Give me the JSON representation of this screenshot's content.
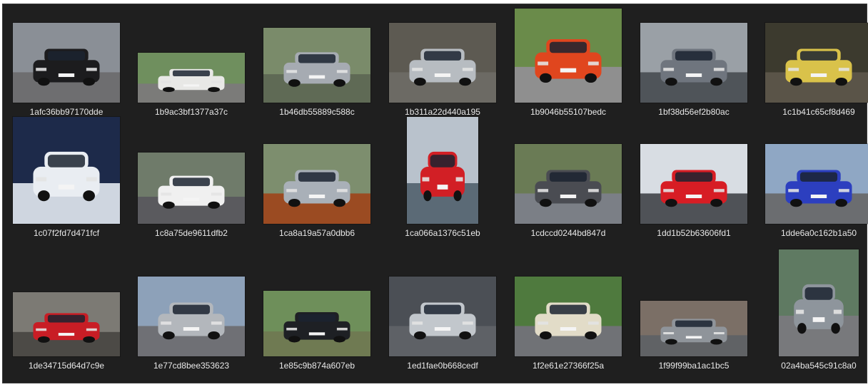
{
  "folder": {
    "files": [
      {
        "name": "1afc36bb97170dde",
        "car_color": "#1c1c1e",
        "bg": "#8a8f96",
        "ground": "#6e6e70"
      },
      {
        "name": "1b9ac3bf1377a37c",
        "car_color": "#e8e8e6",
        "bg": "#6f8f5e",
        "ground": "#7b7b79"
      },
      {
        "name": "1b46db55889c588c",
        "car_color": "#a6abb2",
        "bg": "#7a8b6a",
        "ground": "#5f6a55"
      },
      {
        "name": "1b311a22d440a195",
        "car_color": "#b7bcc1",
        "bg": "#5d5a52",
        "ground": "#6c6a64"
      },
      {
        "name": "1b9046b55107bedc",
        "car_color": "#e0461e",
        "bg": "#6a8b4a",
        "ground": "#8f8f8f"
      },
      {
        "name": "1bf38d56ef2b80ac",
        "car_color": "#6f757e",
        "bg": "#9aa0a6",
        "ground": "#4f5459"
      },
      {
        "name": "1c1b41c65cf8d469",
        "car_color": "#d9c24a",
        "bg": "#3c3a2e",
        "ground": "#5a5448"
      },
      {
        "name": "1c07f2fd7d471fcf",
        "car_color": "#e9edf2",
        "bg": "#1d2a4a",
        "ground": "#cfd6e0"
      },
      {
        "name": "1c8a75de9611dfb2",
        "car_color": "#f0f0f0",
        "bg": "#6f7b6a",
        "ground": "#5a5a5e"
      },
      {
        "name": "1ca8a19a57a0dbb6",
        "car_color": "#a9b0b8",
        "bg": "#7d8e6e",
        "ground": "#9b4b22"
      },
      {
        "name": "1ca066a1376c51eb",
        "car_color": "#d21f25",
        "bg": "#b9c2cc",
        "ground": "#5b6a76"
      },
      {
        "name": "1cdccd0244bd847d",
        "car_color": "#4a4c52",
        "bg": "#6a7b55",
        "ground": "#7b7f86"
      },
      {
        "name": "1dd1b52b63606fd1",
        "car_color": "#d71d24",
        "bg": "#d8dde3",
        "ground": "#4f5257"
      },
      {
        "name": "1dde6a0c162b1a50",
        "car_color": "#2c3fbf",
        "bg": "#8fa7c4",
        "ground": "#6b6d70"
      },
      {
        "name": "1de34715d64d7c9e",
        "car_color": "#c81d25",
        "bg": "#7c7a74",
        "ground": "#4c4a46"
      },
      {
        "name": "1e77cd8bee353623",
        "car_color": "#b3b7bc",
        "bg": "#8da1b9",
        "ground": "#6f7075"
      },
      {
        "name": "1e85c9b874a607eb",
        "car_color": "#1e2024",
        "bg": "#6e8f5a",
        "ground": "#6f7a52"
      },
      {
        "name": "1ed1fae0b668cedf",
        "car_color": "#c2c7cc",
        "bg": "#4b4f55",
        "ground": "#5e6166"
      },
      {
        "name": "1f2e61e27366f25a",
        "car_color": "#e2dcc8",
        "bg": "#4f7a3e",
        "ground": "#707276"
      },
      {
        "name": "1f99f99ba1ac1bc5",
        "car_color": "#8f949a",
        "bg": "#7b6f66",
        "ground": "#606265"
      },
      {
        "name": "02a4ba545c91c8a0",
        "car_color": "#8e959c",
        "bg": "#5f7a62",
        "ground": "#78797c"
      }
    ]
  }
}
